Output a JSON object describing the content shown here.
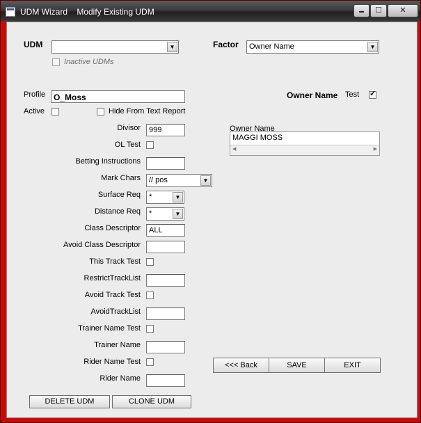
{
  "window": {
    "title": "UDM Wizard    Modify Existing UDM",
    "minimize": "▬",
    "maximize": "☐",
    "close": "✕"
  },
  "udm": {
    "label": "UDM",
    "value": "",
    "inactive_label": "Inactive UDMs"
  },
  "factor": {
    "label": "Factor",
    "value": "Owner Name"
  },
  "profile": {
    "label": "Profile",
    "value": "O_Moss"
  },
  "active_label": "Active",
  "hide_label": "Hide From Text Report",
  "owner_name_header": "Owner Name",
  "test_label": "Test",
  "owner_list": {
    "label": "Owner Name",
    "items": [
      "MAGGI MOSS"
    ]
  },
  "fields": {
    "divisor": {
      "label": "Divisor",
      "value": "999"
    },
    "ol_test": {
      "label": "OL Test"
    },
    "betting_instructions": {
      "label": "Betting Instructions",
      "value": ""
    },
    "mark_chars": {
      "label": "Mark Chars",
      "value": "// pos"
    },
    "surface_req": {
      "label": "Surface Req",
      "value": "*"
    },
    "distance_req": {
      "label": "Distance Req",
      "value": "*"
    },
    "class_descriptor": {
      "label": "Class Descriptor",
      "value": "ALL"
    },
    "avoid_class_descriptor": {
      "label": "Avoid Class Descriptor",
      "value": ""
    },
    "this_track_test": {
      "label": "This Track Test"
    },
    "restrict_track_list": {
      "label": "RestrictTrackList",
      "value": ""
    },
    "avoid_track_test": {
      "label": "Avoid Track Test"
    },
    "avoid_track_list": {
      "label": "AvoidTrackList",
      "value": ""
    },
    "trainer_name_test": {
      "label": "Trainer Name Test"
    },
    "trainer_name": {
      "label": "Trainer Name",
      "value": ""
    },
    "rider_name_test": {
      "label": "Rider Name Test"
    },
    "rider_name": {
      "label": "Rider Name",
      "value": ""
    }
  },
  "buttons": {
    "back": "<<< Back",
    "save": "SAVE",
    "exit": "EXIT",
    "delete": "DELETE UDM",
    "clone": "CLONE UDM"
  },
  "icons": {
    "dropdown": "▼",
    "check": "✓",
    "scroll_left": "◀",
    "scroll_right": "▶"
  }
}
